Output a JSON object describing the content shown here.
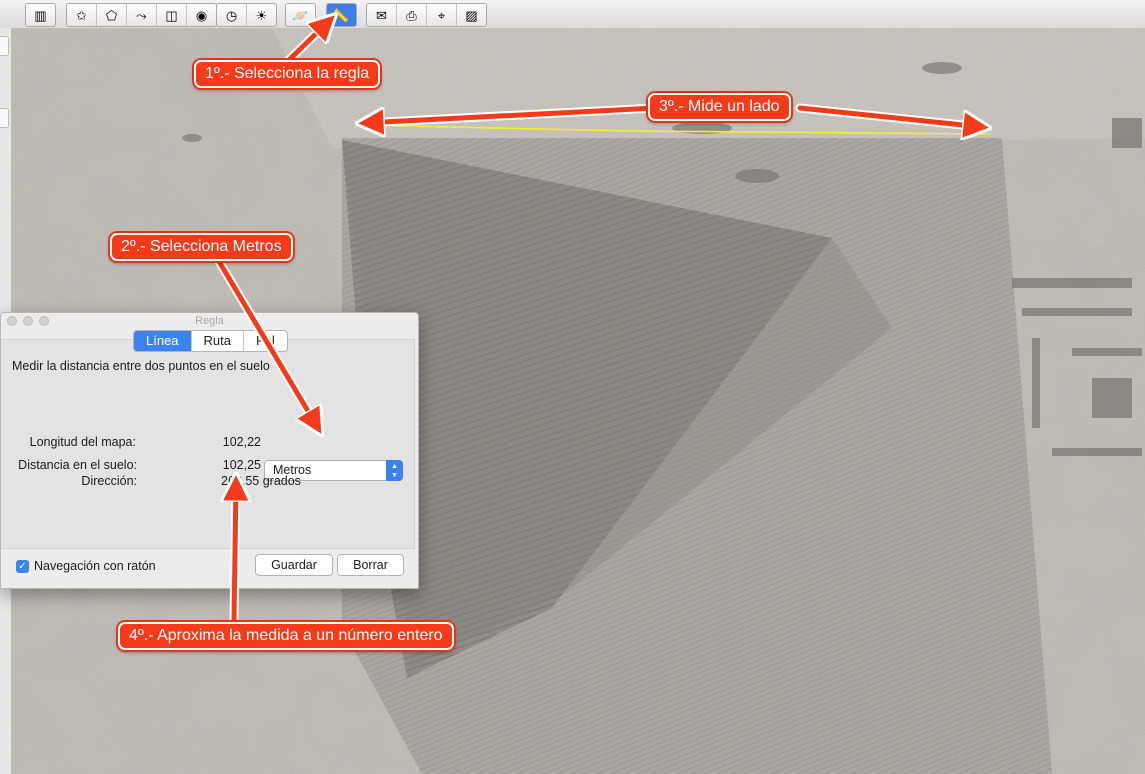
{
  "toolbar": {
    "groups": [
      {
        "id": "sidebar",
        "buttons": [
          {
            "icon": "sidebar-toggle-icon",
            "glyph": "▥"
          }
        ]
      },
      {
        "id": "add",
        "buttons": [
          {
            "icon": "add-placemark-icon",
            "glyph": "✩"
          },
          {
            "icon": "add-polygon-icon",
            "glyph": "⬠"
          },
          {
            "icon": "add-path-icon",
            "glyph": "⤳"
          },
          {
            "icon": "add-image-overlay-icon",
            "glyph": "◫"
          },
          {
            "icon": "record-tour-icon",
            "glyph": "◉"
          }
        ]
      },
      {
        "id": "time",
        "buttons": [
          {
            "icon": "historical-imagery-icon",
            "glyph": "◷"
          },
          {
            "icon": "sunlight-icon",
            "glyph": "☀"
          }
        ]
      },
      {
        "id": "planets",
        "buttons": [
          {
            "icon": "planet-switch-icon",
            "glyph": "🪐"
          }
        ]
      },
      {
        "id": "ruler",
        "buttons": [
          {
            "icon": "ruler-icon",
            "glyph": "📏",
            "active": true
          }
        ]
      },
      {
        "id": "share",
        "buttons": [
          {
            "icon": "email-icon",
            "glyph": "✉"
          },
          {
            "icon": "print-icon",
            "glyph": "⎙"
          },
          {
            "icon": "view-in-maps-icon",
            "glyph": "⌖"
          },
          {
            "icon": "save-image-icon",
            "glyph": "▨"
          }
        ]
      }
    ]
  },
  "dialog": {
    "title": "Regla",
    "tabs": [
      {
        "label": "Línea",
        "active": true
      },
      {
        "label": "Ruta",
        "active": false
      },
      {
        "label": "Pol",
        "active": false
      }
    ],
    "description": "Medir la distancia entre dos puntos en el suelo",
    "map_length_label": "Longitud del mapa:",
    "map_length_value": "102,22",
    "unit_selected": "Metros",
    "ground_distance_label": "Distancia en el suelo:",
    "ground_distance_value": "102,25",
    "direction_label": "Dirección:",
    "direction_value": "262,55 grados",
    "mouse_nav_label": "Navegación con ratón",
    "mouse_nav_checked": true,
    "save_label": "Guardar",
    "clear_label": "Borrar"
  },
  "callouts": {
    "step1": "1º.- Selecciona la regla",
    "step2": "2º.- Selecciona Metros",
    "step3": "3º.- Mide un lado",
    "step4": "4º.- Aproxima la medida a un número entero"
  },
  "colors": {
    "callout": "#f33a1b",
    "measure_line": "#f5f02a",
    "accent": "#3b84f0"
  }
}
